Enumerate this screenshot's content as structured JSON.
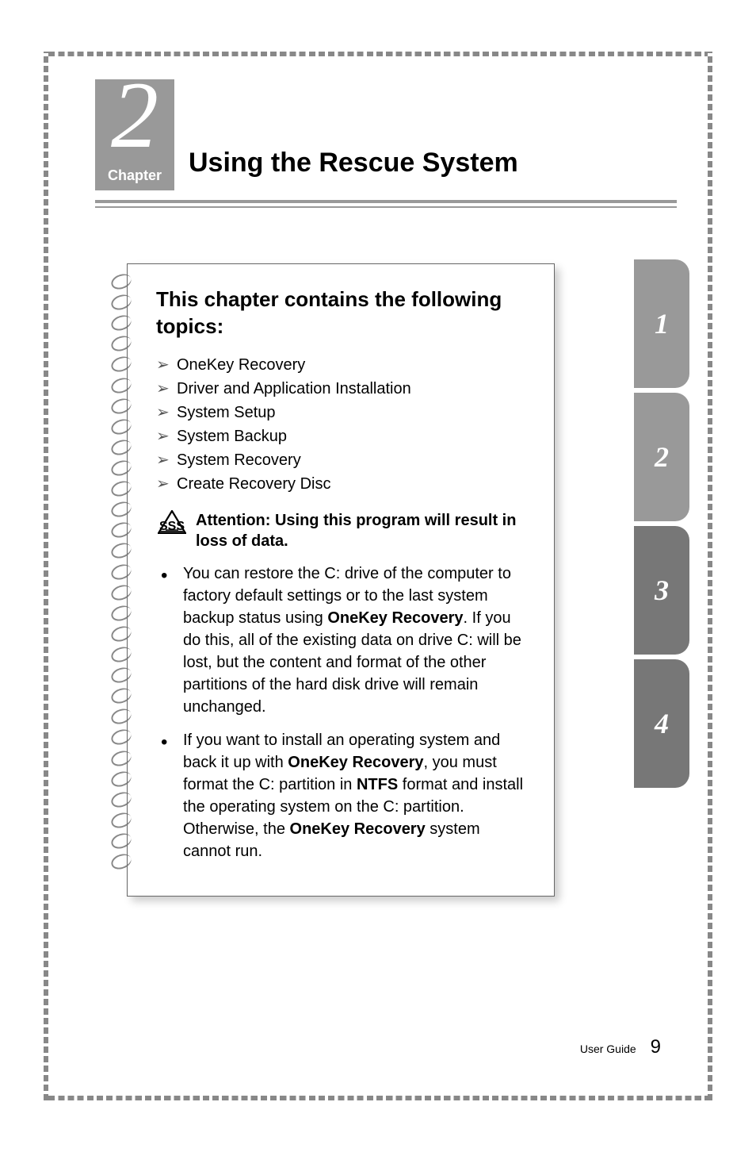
{
  "chapter": {
    "number": "2",
    "label": "Chapter",
    "title": "Using the Rescue System"
  },
  "topics": {
    "heading": "This chapter contains the following topics:",
    "items": [
      "OneKey Recovery",
      "Driver and Application Installation",
      "System Setup",
      "System Backup",
      "System Recovery",
      "Create Recovery Disc"
    ]
  },
  "attention": {
    "label": "Attention: Using this program will result in loss of data.",
    "bullets": [
      {
        "pre": "You can restore the C: drive of the computer to factory default settings or to the last system backup status using ",
        "bold1": "OneKey Recovery",
        "post1": ". If you do this, all of the existing data on drive C: will be lost, but the content and format of the other partitions of the hard disk drive will remain unchanged."
      },
      {
        "pre": "If you want to install an operating system and back it up with ",
        "bold1": "OneKey Recovery",
        "mid": ", you must format the C: partition in ",
        "bold2": "NTFS",
        "post1": " format and install the operating system on the C: partition. Otherwise, the ",
        "bold3": "OneKey Recovery",
        "post2": " system cannot run."
      }
    ]
  },
  "tabs": [
    "1",
    "2",
    "3",
    "4"
  ],
  "footer": {
    "guide": "User Guide",
    "page": "9"
  }
}
